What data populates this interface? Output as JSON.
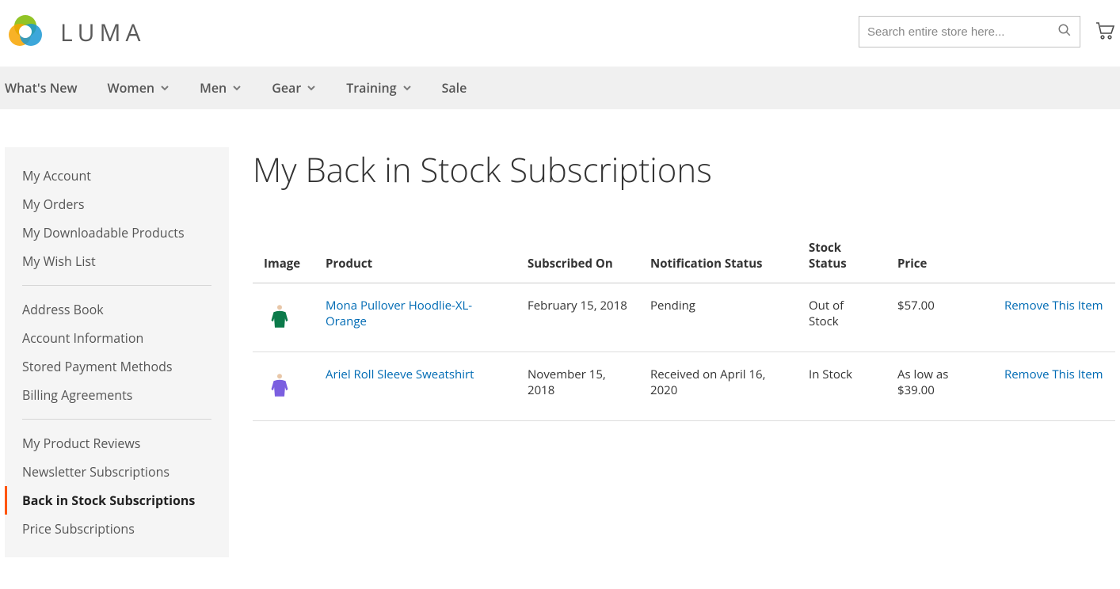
{
  "brand": "LUMA",
  "search": {
    "placeholder": "Search entire store here..."
  },
  "nav": {
    "whatsnew": "What's New",
    "women": "Women",
    "men": "Men",
    "gear": "Gear",
    "training": "Training",
    "sale": "Sale"
  },
  "sidebar": {
    "g1": {
      "my_account": "My Account",
      "my_orders": "My Orders",
      "my_downloadable": "My Downloadable Products",
      "my_wishlist": "My Wish List"
    },
    "g2": {
      "address_book": "Address Book",
      "account_info": "Account Information",
      "stored_payment": "Stored Payment Methods",
      "billing_agreements": "Billing Agreements"
    },
    "g3": {
      "product_reviews": "My Product Reviews",
      "newsletter": "Newsletter Subscriptions",
      "back_in_stock": "Back in Stock Subscriptions",
      "price_subs": "Price Subscriptions"
    }
  },
  "page_title": "My Back in Stock Subscriptions",
  "table": {
    "headers": {
      "image": "Image",
      "product": "Product",
      "subscribed_on": "Subscribed On",
      "notification_status": "Notification Status",
      "stock_status": "Stock Status",
      "price": "Price",
      "remove": ""
    },
    "rows": [
      {
        "product": "Mona Pullover Hoodlie-XL-Orange",
        "subscribed_on": "February 15, 2018",
        "notification_status": "Pending",
        "stock_status": "Out of Stock",
        "price": "$57.00",
        "remove": "Remove This Item",
        "thumb_color": "#0b7a4a"
      },
      {
        "product": "Ariel Roll Sleeve Sweatshirt",
        "subscribed_on": "November 15, 2018",
        "notification_status": "Received on April 16, 2020",
        "stock_status": "In Stock",
        "price": "As low as $39.00",
        "remove": "Remove This Item",
        "thumb_color": "#7b5fe0"
      }
    ]
  }
}
